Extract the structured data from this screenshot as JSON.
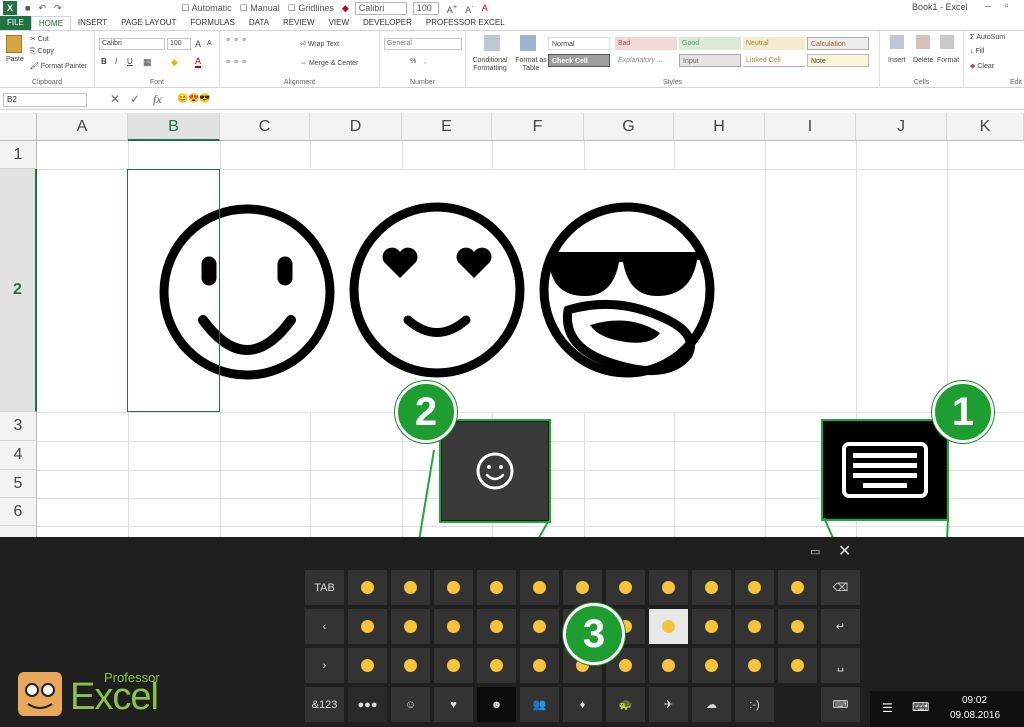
{
  "qat": {
    "automatic": "Automatic",
    "manual": "Manual",
    "gridlines": "Gridlines",
    "font": "Calibri",
    "size": "100",
    "title": "Book1 - Excel"
  },
  "tabs": [
    "FILE",
    "HOME",
    "INSERT",
    "PAGE LAYOUT",
    "FORMULAS",
    "DATA",
    "REVIEW",
    "VIEW",
    "DEVELOPER",
    "PROFESSOR EXCEL"
  ],
  "ribbon": {
    "clipboard": {
      "paste": "Paste",
      "cut": "Cut",
      "copy": "Copy",
      "format_painter": "Format Painter",
      "label": "Clipboard"
    },
    "font": {
      "name": "Calibri",
      "size": "100",
      "bold": "B",
      "italic": "I",
      "underline": "U",
      "grow": "A",
      "shrink": "A",
      "label": "Font"
    },
    "alignment": {
      "wrap": "Wrap Text",
      "merge": "Merge & Center",
      "label": "Alignment"
    },
    "number": {
      "format": "General",
      "pct": "%",
      "comma": ",",
      "label": "Number"
    },
    "styles": {
      "conditional": "Conditional Formatting",
      "format_table": "Format as Table",
      "cells": [
        "Normal",
        "Bad",
        "Good",
        "Neutral",
        "Calculation",
        "Check Cell",
        "Explanatory ...",
        "Input",
        "Linked Cell",
        "Note"
      ],
      "label": "Styles"
    },
    "cells": {
      "insert": "Insert",
      "delete": "Delete",
      "format": "Format",
      "label": "Cells"
    },
    "editing": {
      "autosum": "AutoSum",
      "fill": "Fill",
      "clear": "Clear",
      "label": "Edit"
    }
  },
  "formula_bar": {
    "name_box": "B2",
    "content": "😊😍😎",
    "cancel": "✕",
    "enter": "✓",
    "fx": "fx"
  },
  "columns": [
    "A",
    "B",
    "C",
    "D",
    "E",
    "F",
    "G",
    "H",
    "I",
    "J",
    "K"
  ],
  "rows": [
    "1",
    "2",
    "3",
    "4",
    "5",
    "6"
  ],
  "selected_col": "B",
  "selected_row": "2",
  "badges": {
    "one": "1",
    "two": "2",
    "three": "3"
  },
  "keyboard": {
    "tab": "TAB",
    "num": "&123",
    "emoticon": ":-)",
    "dots": "●●●"
  },
  "tray": {
    "time": "09:02",
    "date": "09.08.2016"
  },
  "logo": {
    "professor": "Professor",
    "excel": "Excel"
  },
  "colors": {
    "excel_green": "#217346",
    "badge_green": "#1e9e31",
    "keyboard_bg": "#1f1f1f",
    "key_bg": "#333333"
  }
}
